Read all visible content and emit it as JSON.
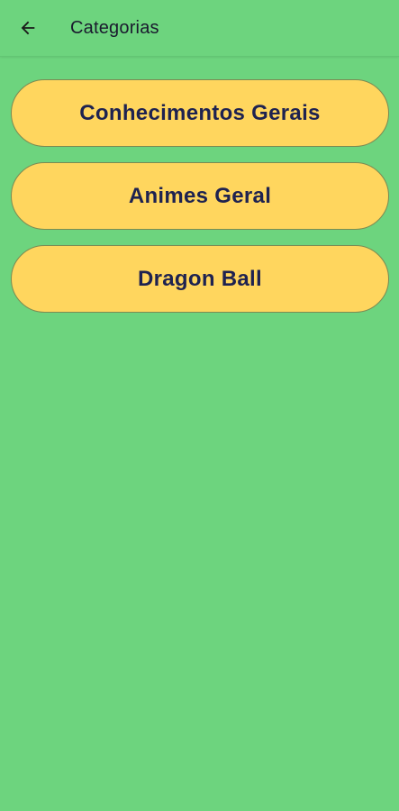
{
  "app_bar": {
    "back_icon": "arrow-left-icon",
    "title": "Categorias"
  },
  "categories": [
    {
      "label": "Conhecimentos Gerais"
    },
    {
      "label": "Animes Geral"
    },
    {
      "label": "Dragon Ball"
    }
  ],
  "colors": {
    "background": "#6dd47e",
    "button": "#ffd65e",
    "button_text": "#1e2250",
    "title_text": "#1a1a2e"
  }
}
